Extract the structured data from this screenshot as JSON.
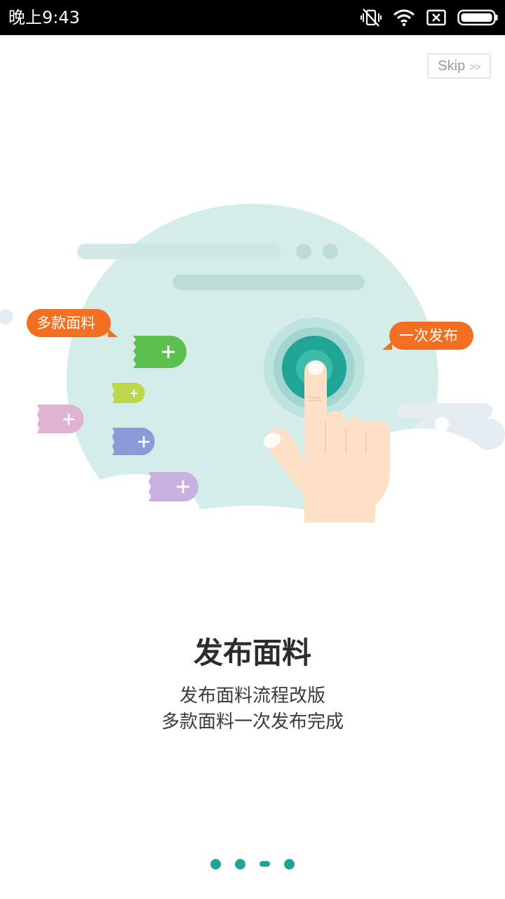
{
  "status_bar": {
    "time": "晚上9:43",
    "icons": [
      "vibrate-off-icon",
      "wifi-icon",
      "sim-off-icon",
      "battery-icon"
    ]
  },
  "skip": {
    "label": "Skip",
    "arrows": ">>"
  },
  "illustration": {
    "bubble_left": "多款面料",
    "bubble_right": "一次发布",
    "colors": {
      "circle_bg": "#d4ede9",
      "button": "#1fa595",
      "bubble": "#f26f21",
      "tag_green": "#5cbf4f",
      "tag_lime": "#bcd84a",
      "tag_pink": "#e0b3d3",
      "tag_blue": "#8a9bd8",
      "tag_purple": "#c8b1e0",
      "hand": "#fde0c5"
    }
  },
  "content": {
    "title": "发布面料",
    "subtitle_line1": "发布面料流程改版",
    "subtitle_line2": "多款面料一次发布完成"
  },
  "page_indicator": {
    "total": 4,
    "active_index": 2,
    "color": "#1fa595"
  }
}
